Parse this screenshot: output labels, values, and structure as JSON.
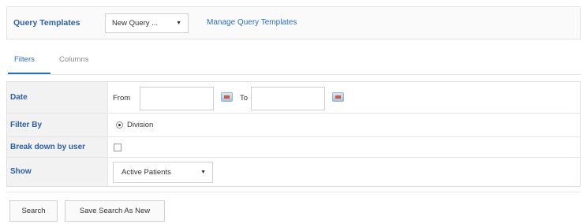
{
  "query_templates": {
    "label": "Query Templates",
    "selected": "New Query ...",
    "manage_link": "Manage Query Templates"
  },
  "tabs": [
    {
      "label": "Filters",
      "active": true
    },
    {
      "label": "Columns",
      "active": false
    }
  ],
  "filters": {
    "date": {
      "label": "Date",
      "from_label": "From",
      "from_value": "",
      "to_label": "To",
      "to_value": ""
    },
    "filter_by": {
      "label": "Filter By",
      "option": "Division",
      "selected": true
    },
    "break_down": {
      "label": "Break down by user",
      "checked": false
    },
    "show": {
      "label": "Show",
      "selected": "Active Patients"
    }
  },
  "actions": {
    "search": "Search",
    "save_new": "Save Search As New"
  },
  "colors": {
    "accent": "#2a6fc0",
    "label": "#2a5ea8"
  }
}
